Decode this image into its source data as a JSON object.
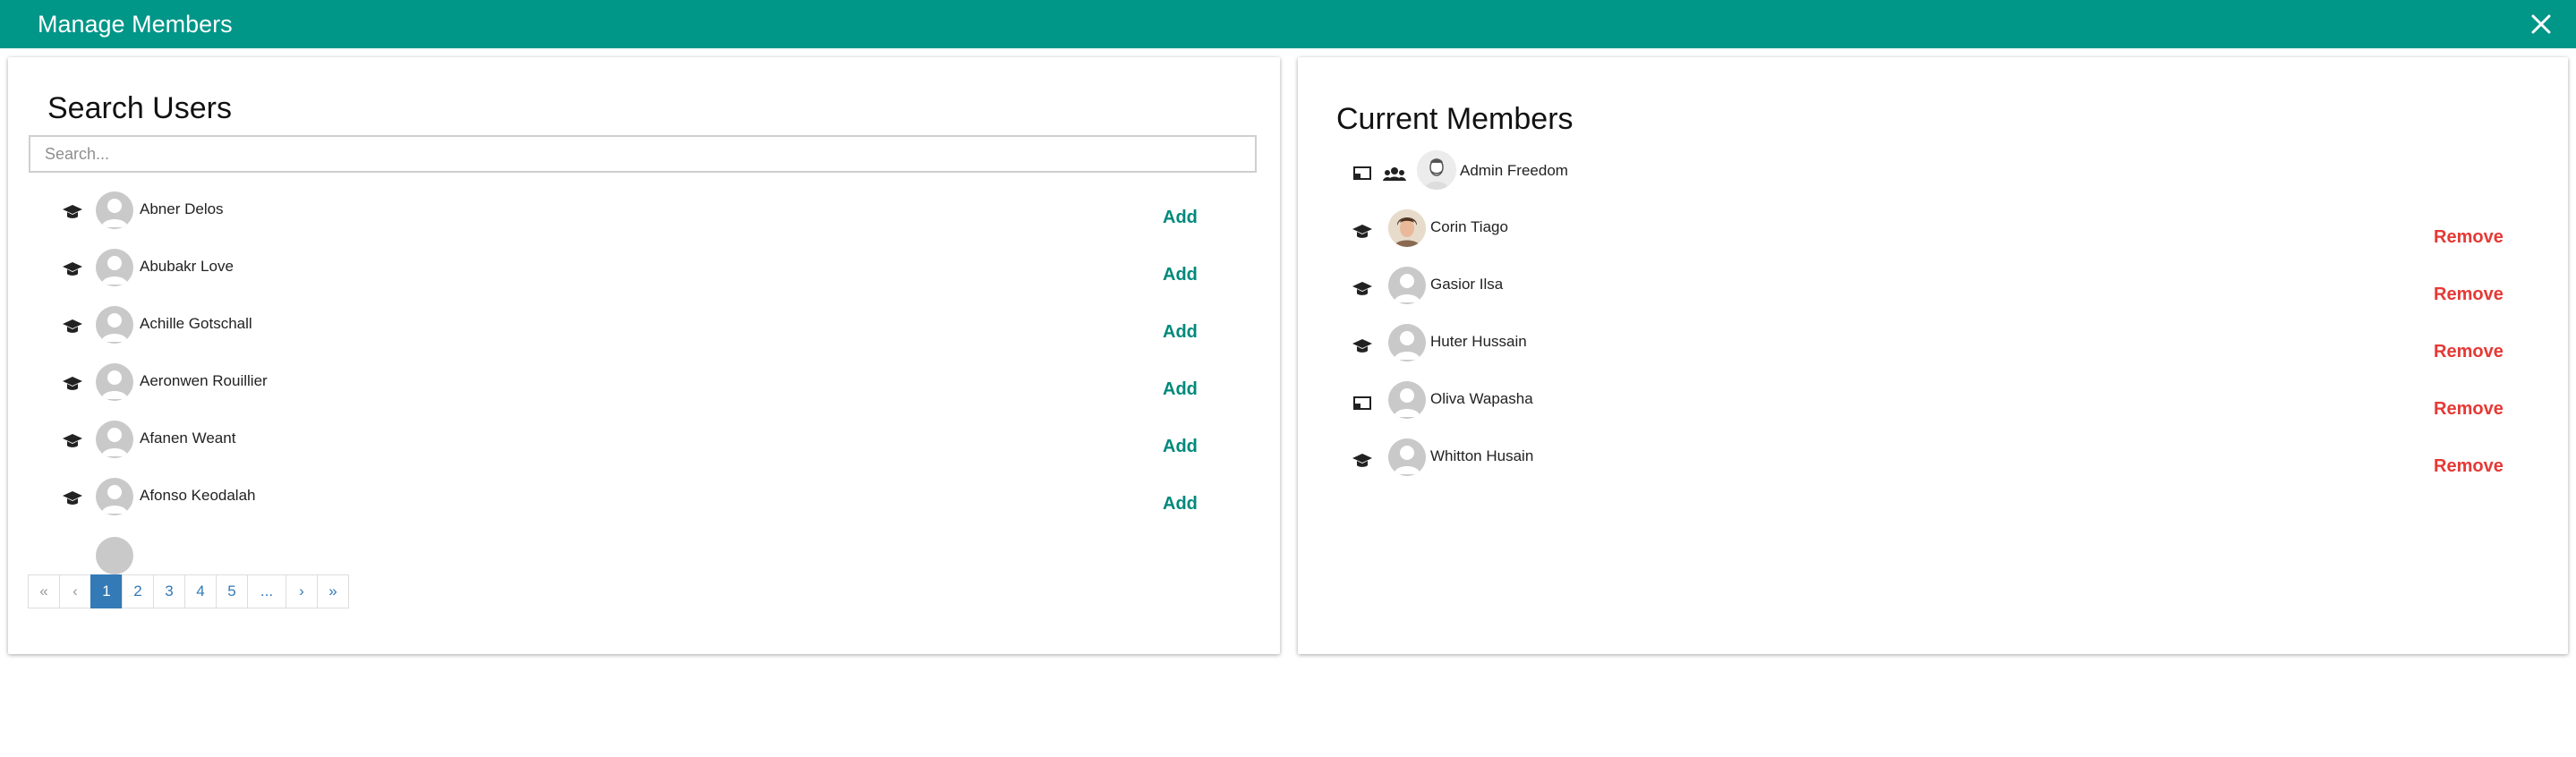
{
  "header": {
    "title": "Manage Members",
    "close_icon": "close-icon"
  },
  "colors": {
    "header_bg": "#009688",
    "add": "#00897b",
    "remove": "#e53935",
    "page_active": "#337ab7"
  },
  "search_panel": {
    "title": "Search Users",
    "search_placeholder": "Search...",
    "search_value": "",
    "add_label": "Add",
    "users": [
      {
        "name": "Abner Delos",
        "icon": "graduation-cap-icon"
      },
      {
        "name": "Abubakr Love",
        "icon": "graduation-cap-icon"
      },
      {
        "name": "Achille Gotschall",
        "icon": "graduation-cap-icon"
      },
      {
        "name": "Aeronwen Rouillier",
        "icon": "graduation-cap-icon"
      },
      {
        "name": "Afanen Weant",
        "icon": "graduation-cap-icon"
      },
      {
        "name": "Afonso Keodalah",
        "icon": "graduation-cap-icon"
      }
    ],
    "pagination": {
      "first": "«",
      "prev": "‹",
      "pages": [
        "1",
        "2",
        "3",
        "4",
        "5"
      ],
      "ellipsis": "...",
      "next": "›",
      "last": "»",
      "current": "1"
    }
  },
  "members_panel": {
    "title": "Current Members",
    "remove_label": "Remove",
    "owner": {
      "name": "Admin Freedom",
      "icons": [
        "teacher-board-icon",
        "group-icon"
      ]
    },
    "members": [
      {
        "name": "Corin Tiago",
        "icon": "graduation-cap-icon",
        "photo": true
      },
      {
        "name": "Gasior Ilsa",
        "icon": "graduation-cap-icon"
      },
      {
        "name": "Huter Hussain",
        "icon": "graduation-cap-icon"
      },
      {
        "name": "Oliva Wapasha",
        "icon": "teacher-board-icon"
      },
      {
        "name": "Whitton Husain",
        "icon": "graduation-cap-icon"
      }
    ]
  }
}
